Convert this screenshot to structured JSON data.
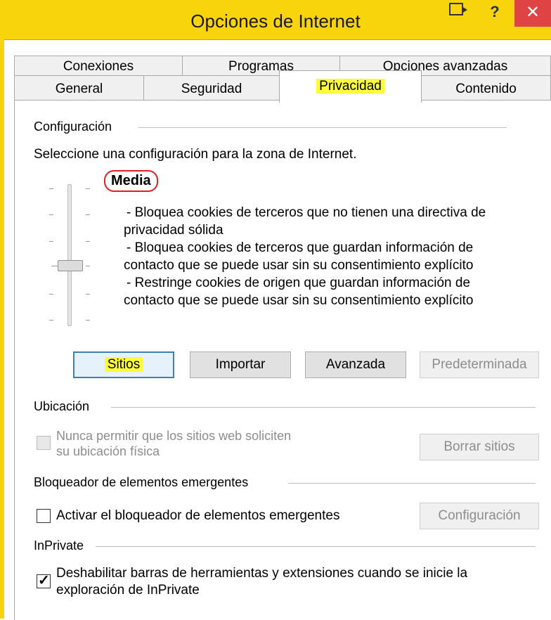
{
  "window": {
    "title": "Opciones de Internet",
    "help_glyph": "?",
    "close_glyph": "✕",
    "accent_color": "#f8d40c",
    "highlight_color": "#fcfc3c",
    "close_color": "#e04343"
  },
  "tabs": {
    "row1": [
      "Conexiones",
      "Programas",
      "Opciones avanzadas"
    ],
    "row2": [
      "General",
      "Seguridad",
      "Privacidad",
      "Contenido"
    ],
    "active": "Privacidad"
  },
  "config": {
    "group_title": "Configuración",
    "instruction": "Seleccione una configuración para la zona de Internet.",
    "level": "Media",
    "level_circle_color": "#e41e26",
    "description_lines": [
      "- Bloquea cookies de terceros que no tienen una directiva de",
      "privacidad sólida",
      "- Bloquea cookies de terceros que guardan información de",
      "contacto que se puede usar sin su consentimiento explícito",
      "- Restringe cookies de origen que guardan información de",
      "contacto que se puede usar sin su consentimiento explícito"
    ],
    "buttons": {
      "sites": "Sitios",
      "import": "Importar",
      "advanced": "Avanzada",
      "default": "Predeterminada"
    }
  },
  "location": {
    "group_title": "Ubicación",
    "checkbox_line1": "Nunca permitir que los sitios web soliciten",
    "checkbox_line2": "su ubicación física",
    "checked": false,
    "clear_button": "Borrar sitios"
  },
  "popup": {
    "group_title": "Bloqueador de elementos emergentes",
    "checkbox_label": "Activar el bloqueador de elementos emergentes",
    "checked": false,
    "settings_button": "Configuración"
  },
  "inprivate": {
    "group_title": "InPrivate",
    "checkbox_line1": "Deshabilitar barras de herramientas y extensiones cuando se inicie la",
    "checkbox_line2": "exploración de InPrivate",
    "checked": true,
    "check_glyph": "✓"
  }
}
